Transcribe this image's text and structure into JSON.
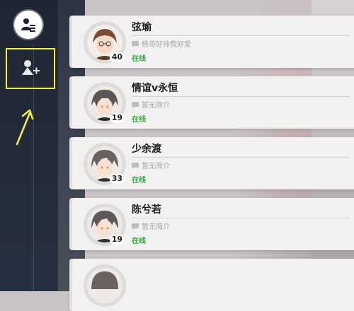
{
  "friends": [
    {
      "name": "弦瑜",
      "level": "40",
      "bio": "杨哥好帅我好爱",
      "status": "在线"
    },
    {
      "name": "情谊v永恒",
      "level": "19",
      "bio": "暂无简介",
      "status": "在线"
    },
    {
      "name": "少余渡",
      "level": "33",
      "bio": "暂无简介",
      "status": "在线"
    },
    {
      "name": "陈兮若",
      "level": "19",
      "bio": "暂无简介",
      "status": "在线"
    }
  ],
  "colors": {
    "highlight": "#f2f23a",
    "online": "#3aa844"
  },
  "icons": {
    "profile": "profile-list-icon",
    "add_friend": "add-friend-icon"
  }
}
